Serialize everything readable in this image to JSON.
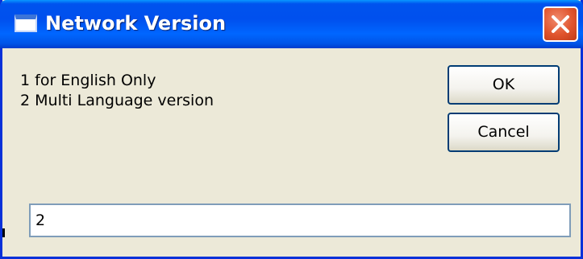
{
  "window": {
    "title": "Network Version",
    "close_icon": "close-icon",
    "colors": {
      "titlebar": "#0054e3",
      "frame": "#0831d9",
      "body": "#ece9d8",
      "close": "#e0542d"
    }
  },
  "message": {
    "line1": "1 for English Only",
    "line2": "2 Multi Language version"
  },
  "buttons": {
    "ok_label": "OK",
    "cancel_label": "Cancel"
  },
  "input": {
    "value": "2"
  }
}
